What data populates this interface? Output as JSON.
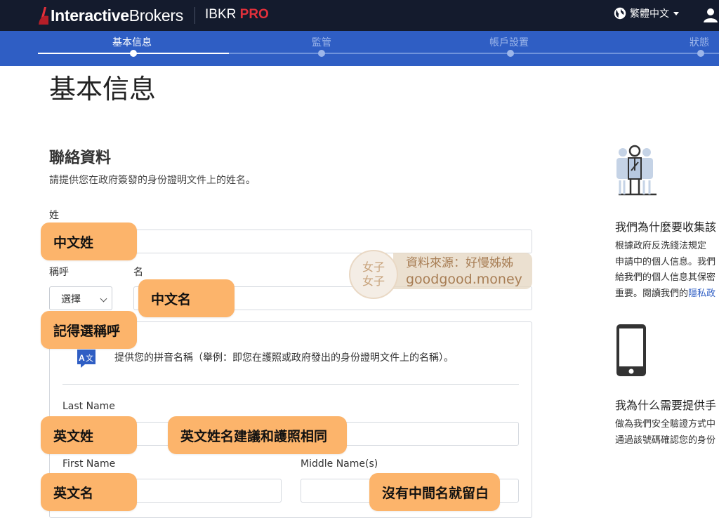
{
  "header": {
    "brand_interactive": "Interactive",
    "brand_brokers": "Brokers",
    "product_ibkr": "IBKR",
    "product_pro": "PRO",
    "language": "繁體中文",
    "icons": {
      "logo": "ib-logo-icon",
      "globe": "globe-icon",
      "user": "user-icon"
    }
  },
  "steps": [
    {
      "label": "基本信息",
      "active": true
    },
    {
      "label": "監管",
      "active": false
    },
    {
      "label": "帳戶設置",
      "active": false
    },
    {
      "label": "狀態",
      "active": false
    }
  ],
  "page": {
    "title": "基本信息",
    "section_title": "聯絡資料",
    "section_desc": "請提供您在政府簽發的身份證明文件上的姓名。",
    "labels": {
      "surname": "姓",
      "salutation": "稱呼",
      "given_name": "名",
      "last_name": "Last Name",
      "first_name": "First Name",
      "middle_name": "Middle Name(s)"
    },
    "salutation_select": "選擇",
    "pinyin_note": "提供您的拼音名稱（舉例：即您在護照或政府發出的身份證明文件上的名稱）。"
  },
  "sidebar": {
    "why_collect_title": "我們為什麼要收集該",
    "why_collect_text": [
      "根據政府反洗錢法規定",
      "申請中的個人信息。我們",
      "給我們的個人信息其保密",
      "重要。閱讀我們的"
    ],
    "privacy_link": "隱私政",
    "why_phone_title": "我為什么需要提供手",
    "why_phone_text": [
      "做為我們安全驗證方式中",
      "通過該號碼確認您的身份"
    ]
  },
  "annotations": {
    "chinese_surname": "中文姓",
    "chinese_given": "中文名",
    "remember_salutation": "記得選稱呼",
    "english_surname": "英文姓",
    "english_match_passport": "英文姓名建議和護照相同",
    "english_given": "英文名",
    "no_middle_name": "沒有中間名就留白"
  },
  "watermark": {
    "logo_line1": "女子",
    "logo_line2": "女子",
    "source": "資料來源：好慢姊姊",
    "site": "goodgood.money"
  },
  "colors": {
    "topbar": "#141b2d",
    "stepsbar": "#2f5ec4",
    "brand_red": "#e3303b",
    "tag_orange": "#fcb46b"
  }
}
